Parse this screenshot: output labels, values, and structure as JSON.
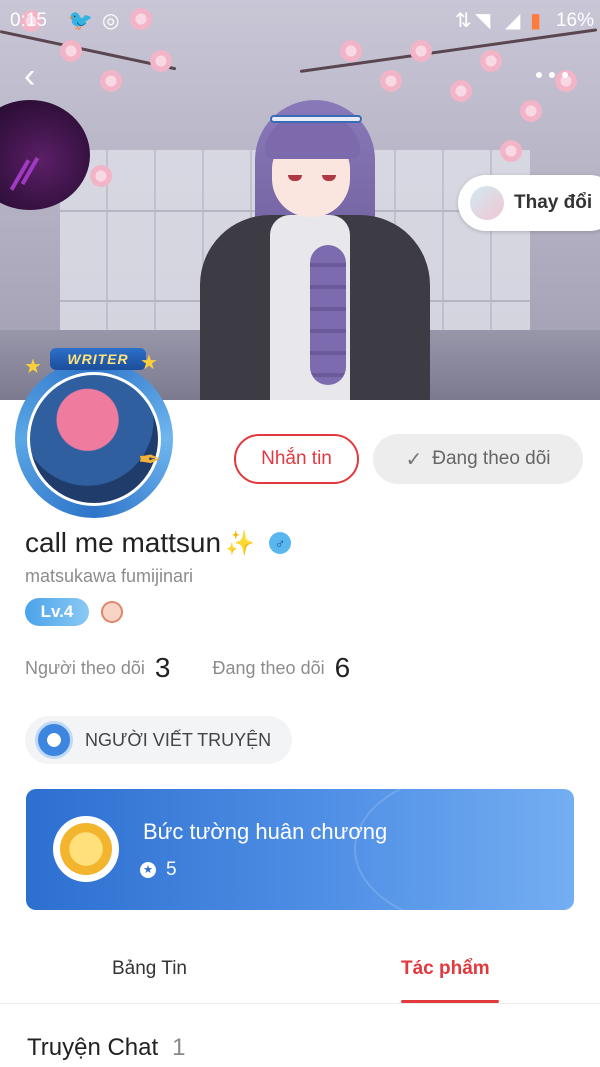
{
  "status_bar": {
    "time": "0:15",
    "battery": "16%"
  },
  "cover": {
    "change_label": "Thay đổi"
  },
  "profile": {
    "avatar_badge": "WRITER",
    "display_name": "call me mattsun",
    "username": "matsukawa fumijinari",
    "level": "Lv.4"
  },
  "actions": {
    "message": "Nhắn tin",
    "following": "Đang theo dõi"
  },
  "stats": {
    "followers_label": "Người theo dõi",
    "followers_value": "3",
    "following_label": "Đang theo dõi",
    "following_value": "6"
  },
  "role": {
    "label": "NGƯỜI VIẾT TRUYỆN"
  },
  "medal_wall": {
    "title": "Bức tường huân chương",
    "count": "5"
  },
  "tabs": [
    {
      "label": "Bảng Tin"
    },
    {
      "label": "Tác phẩm"
    }
  ],
  "section": {
    "title": "Truyện Chat",
    "count": "1"
  },
  "colors": {
    "accent": "#e2393e",
    "medal_card": "#3a7fdc",
    "level": "#4aa3ea"
  }
}
